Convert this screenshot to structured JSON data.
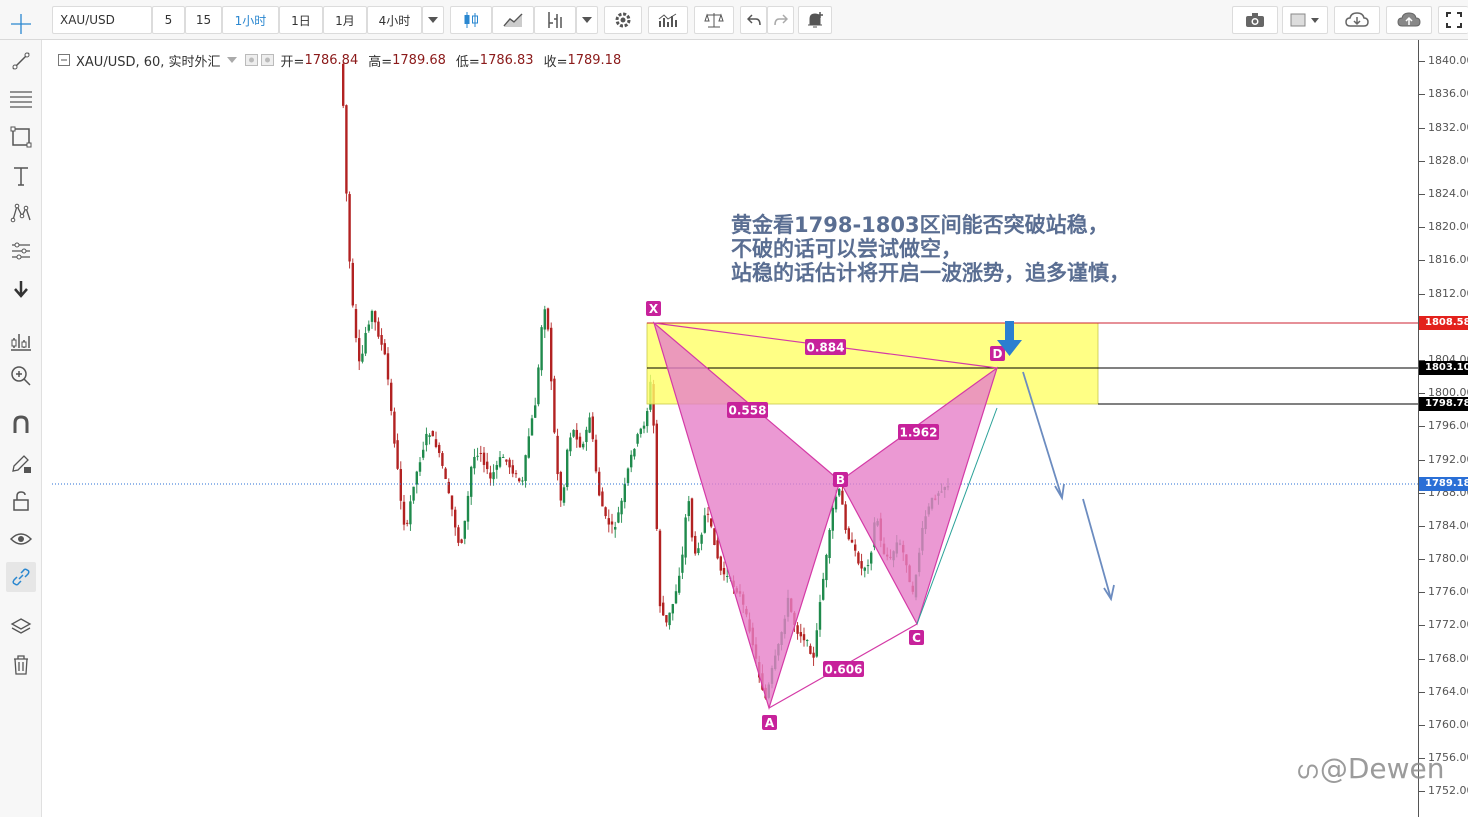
{
  "toolbar": {
    "symbol": "XAU/USD",
    "intervals": [
      "5",
      "15",
      "1小时",
      "1日",
      "1月",
      "4小时"
    ],
    "active_interval": "1小时"
  },
  "legend": {
    "title": "XAU/USD, 60, 实时外汇",
    "open_label": "开=",
    "open": "1786.84",
    "high_label": "高=",
    "high": "1789.68",
    "low_label": "低=",
    "low": "1786.83",
    "close_label": "收=",
    "close": "1789.18"
  },
  "price_axis": {
    "ticks": [
      "1840.00",
      "1836.00",
      "1832.00",
      "1828.00",
      "1824.00",
      "1820.00",
      "1816.00",
      "1812.00",
      "1804.00",
      "1800.00",
      "1796.00",
      "1792.00",
      "1788.00",
      "1784.00",
      "1780.00",
      "1776.00",
      "1772.00",
      "1768.00",
      "1764.00",
      "1760.00",
      "1756.00",
      "1752.00"
    ],
    "labels": [
      {
        "value": "1808.58",
        "color": "#e3211c"
      },
      {
        "value": "1803.10",
        "color": "#000000"
      },
      {
        "value": "1798.78",
        "color": "#000000"
      },
      {
        "value": "1789.18",
        "color": "#2a6fd6"
      }
    ]
  },
  "pattern": {
    "points": [
      "X",
      "A",
      "B",
      "C",
      "D"
    ],
    "ratios": [
      "0.884",
      "0.558",
      "1.962",
      "0.606"
    ]
  },
  "annotation": {
    "lines": [
      "黄金看1798-1803区间能否突破站稳，",
      "不破的话可以尝试做空，",
      "站稳的话估计将开启一波涨势，追多谨慎，"
    ]
  },
  "watermark": "@Dewen",
  "colors": {
    "up": "#1f8a4c",
    "down": "#b22222",
    "zone": "#ffff66",
    "pattern_fill": "#e680c8",
    "pattern_line": "#d43aa6",
    "arrow": "#2b6fbf",
    "annotation": "#5a6e92"
  }
}
